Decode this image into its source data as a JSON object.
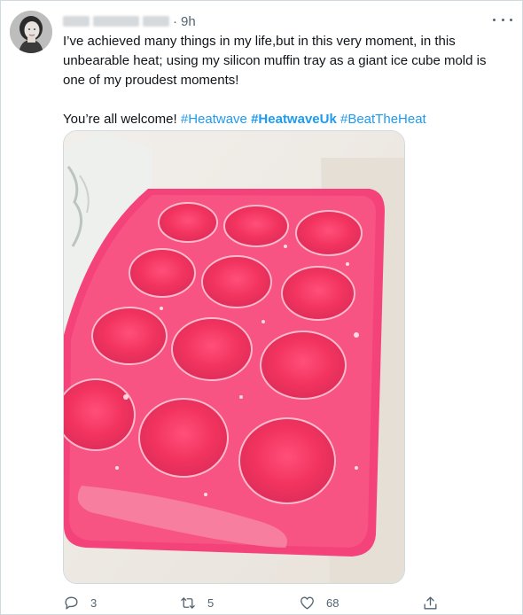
{
  "tweet": {
    "time": "9h",
    "separator": "·",
    "text_line1": "I’ve achieved many things in my life,but in this very moment, in this unbearable heat; using my silicon muffin tray as a giant ice cube mold is one of my proudest moments!",
    "text_prefix": "You’re all welcome! ",
    "hashtags": [
      {
        "text": "#Heatwave",
        "bold": false
      },
      {
        "text": "#HeatwaveUk",
        "bold": true
      },
      {
        "text": "#BeatTheHeat",
        "bold": false
      }
    ]
  },
  "actions": {
    "replies": "3",
    "retweets": "5",
    "likes": "68",
    "icons": [
      "reply-icon",
      "retweet-icon",
      "like-icon",
      "share-icon"
    ]
  },
  "colors": {
    "accent": "#1d9bf0",
    "muted": "#536471",
    "tray": "#ea3d6e"
  }
}
